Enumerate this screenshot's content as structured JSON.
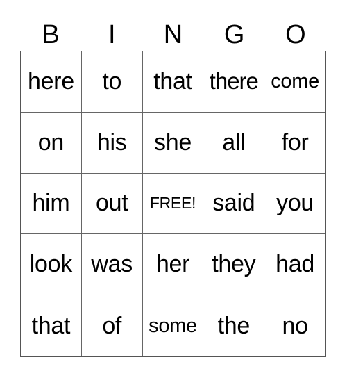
{
  "header": [
    "B",
    "I",
    "N",
    "G",
    "O"
  ],
  "cells": [
    [
      "here",
      "to",
      "that",
      "there",
      "come"
    ],
    [
      "on",
      "his",
      "she",
      "all",
      "for"
    ],
    [
      "him",
      "out",
      "FREE!",
      "said",
      "you"
    ],
    [
      "look",
      "was",
      "her",
      "they",
      "had"
    ],
    [
      "that",
      "of",
      "some",
      "the",
      "no"
    ]
  ]
}
